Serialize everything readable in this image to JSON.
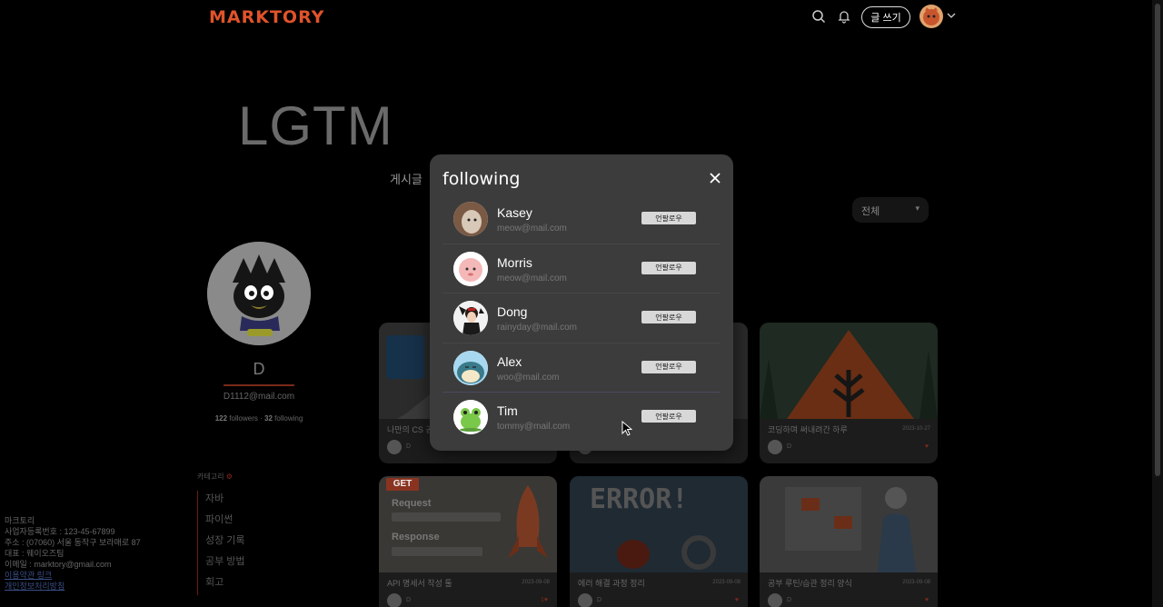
{
  "header": {
    "logo": "MARKTORY",
    "write_label": "글 쓰기"
  },
  "blog": {
    "title": "LGTM",
    "tab_posts": "게시글",
    "filter_value": "전체"
  },
  "profile": {
    "name": "D",
    "email": "D1112@mail.com",
    "followers_count": "122",
    "followers_label": "followers",
    "separator": "·",
    "following_count": "32",
    "following_label": "following",
    "categories_label": "카테고리",
    "categories": [
      "자바",
      "파이썬",
      "성장 기록",
      "공부 방법",
      "회고"
    ]
  },
  "footer": {
    "lines": [
      "마크토리",
      "사업자등록번호 : 123-45-67899",
      "주소 : (07060) 서울 동작구 보라매로 87",
      "대표 : 웨이오즈팀",
      "이메일 : marktory@gmail.com"
    ],
    "links": [
      "이용약관 링크",
      "개인정보처리방침"
    ]
  },
  "cards": [
    {
      "title": "나만의 CS 공부법",
      "date": "",
      "author": "D",
      "likes": ""
    },
    {
      "title": "",
      "date": "",
      "author": "D",
      "likes": ""
    },
    {
      "title": "코딩하며 써내려간 하루",
      "date": "2023-10-27",
      "author": "D",
      "likes": "♥"
    },
    {
      "title": "API 명세서 작성 툴",
      "date": "2023-09-08",
      "author": "D",
      "likes": "1♥"
    },
    {
      "title": "에러 해결 과정 정리",
      "date": "2023-09-08",
      "author": "D",
      "likes": "♥"
    },
    {
      "title": "공부 루틴/습관 정리 양식",
      "date": "2023-09-08",
      "author": "D",
      "likes": "♥"
    }
  ],
  "card_thumb_text": {
    "get": "GET",
    "request": "Request",
    "response": "Response",
    "error": "ERROR!"
  },
  "modal": {
    "title": "following",
    "unfollow_label": "언팔로우",
    "users": [
      {
        "name": "Kasey",
        "email": "meow@mail.com"
      },
      {
        "name": "Morris",
        "email": "meow@mail.com"
      },
      {
        "name": "Dong",
        "email": "rainyday@mail.com"
      },
      {
        "name": "Alex",
        "email": "woo@mail.com"
      },
      {
        "name": "Tim",
        "email": "tommy@mail.com"
      }
    ]
  },
  "colors": {
    "brand": "#e0532b",
    "modal_bg": "#3c3c3c",
    "button_bg": "#d8d8d8"
  }
}
